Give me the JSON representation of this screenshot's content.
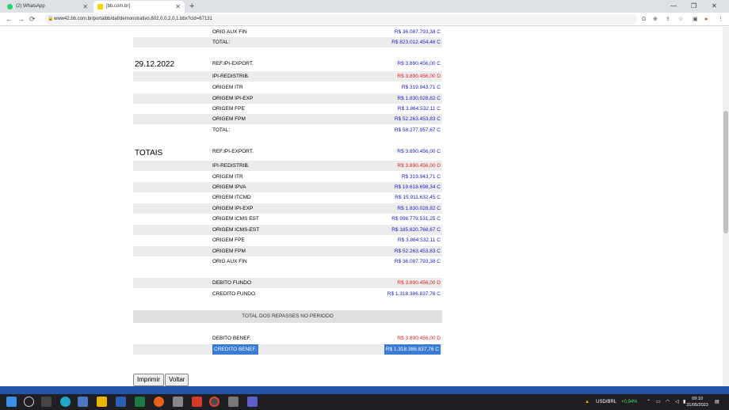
{
  "browser": {
    "tabs": [
      {
        "label": "(2) WhatsApp",
        "color": "#25d366"
      },
      {
        "label": "[bb.com.br]",
        "color": "#f5d800"
      }
    ],
    "url": "www42.bb.com.br/portalbb/daf/demonstrativo,802,0,0,2,0,1.bbx?cid=67131",
    "new_tab": "+",
    "win_min": "—",
    "win_max": "❐",
    "win_close": "✕",
    "back": "←",
    "forward": "→",
    "reload": "⟳",
    "lock": "🔒",
    "toolbar_icons": [
      "G",
      "⊕",
      "⇪",
      "☆",
      "▣",
      "●",
      "⋮"
    ]
  },
  "section_top": {
    "rows": [
      {
        "label": "ORIG AUX FIN",
        "value": "R$ 36.087.793,38 C",
        "neg": false
      },
      {
        "label": "TOTAL:",
        "value": "R$ 823.012.454,46 C",
        "neg": false
      }
    ]
  },
  "section_date": {
    "date": "29.12.2022",
    "rows": [
      {
        "label": "REF.IPI-EXPORT.",
        "value": "R$ 3.890.456,00 C",
        "neg": false
      },
      {
        "label": "IPI-REDISTRIB.",
        "value": "R$ 3.890.456,00 D",
        "neg": true
      },
      {
        "label": "ORIGEM ITR",
        "value": "R$ 319.943,71 C",
        "neg": false
      },
      {
        "label": "ORIGEM IPI-EXP",
        "value": "R$ 1.830.028,82 C",
        "neg": false
      },
      {
        "label": "ORIGEM FPE",
        "value": "R$ 3.864.532,11 C",
        "neg": false
      },
      {
        "label": "ORIGEM FPM",
        "value": "R$ 52.263.453,83 C",
        "neg": false
      },
      {
        "label": "TOTAL:",
        "value": "R$ 58.277.957,67 C",
        "neg": false
      }
    ]
  },
  "section_totais": {
    "title": "TOTAIS",
    "rows": [
      {
        "label": "REF.IPI-EXPORT.",
        "value": "R$ 3.890.456,00 C",
        "neg": false
      },
      {
        "label": "IPI-REDISTRIB.",
        "value": "R$ 3.890.456,00 D",
        "neg": true
      },
      {
        "label": "ORIGEM ITR",
        "value": "R$ 319.943,71 C",
        "neg": false
      },
      {
        "label": "ORIGEM IPVA",
        "value": "R$ 19.618.698,34 C",
        "neg": false
      },
      {
        "label": "ORIGEM ITCMD",
        "value": "R$ 15.911.632,45 C",
        "neg": false
      },
      {
        "label": "ORIGEM IPI-EXP",
        "value": "R$ 1.830.028,82 C",
        "neg": false
      },
      {
        "label": "ORIGEM ICMS EST",
        "value": "R$ 998.779.531,25 C",
        "neg": false
      },
      {
        "label": "ORIGEM ICMS-EST",
        "value": "R$ 185.820.768,67 C",
        "neg": false
      },
      {
        "label": "ORIGEM FPE",
        "value": "R$ 3.864.532,11 C",
        "neg": false
      },
      {
        "label": "ORIGEM FPM",
        "value": "R$ 52.263.453,83 C",
        "neg": false
      },
      {
        "label": "ORIG AUX FIN",
        "value": "R$ 36.087.793,38 C",
        "neg": false
      }
    ]
  },
  "section_fundo": {
    "rows": [
      {
        "label": "DEBITO FUNDO",
        "value": "R$ 3.890.456,00 D",
        "neg": true
      },
      {
        "label": "CREDITO FUNDO",
        "value": "R$ 1.318.386.837,76 C",
        "neg": false
      }
    ]
  },
  "banner": "TOTAL DOS REPASSES NO PERIODO",
  "section_benef": {
    "rows": [
      {
        "label": "DEBITO BENEF.",
        "value": "R$ 3.890.456,00 D",
        "neg": true
      },
      {
        "label": "CREDITO BENEF.",
        "value": "R$ 1.318.386.837,76 C",
        "neg": false
      }
    ]
  },
  "buttons": {
    "print": "Imprimir",
    "back": "Voltar"
  },
  "taskbar": {
    "ticker": "USD/BRL",
    "ticker_change": "+0,94%",
    "time": "09:10",
    "date": "31/05/2023"
  }
}
